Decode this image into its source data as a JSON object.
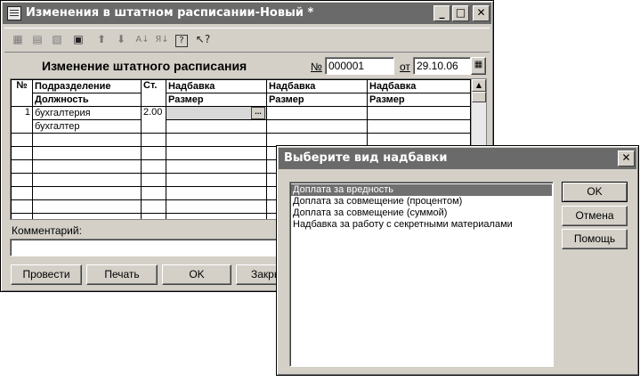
{
  "main_window": {
    "title": "Изменения в штатном расписании-Новый *",
    "controls": {
      "minimize": "_",
      "maximize": "□",
      "close": "✕"
    },
    "toolbar_icons": [
      "new-row-icon",
      "copy-row-icon",
      "delete-row-icon",
      "edit-row-icon",
      "move-up-icon",
      "move-down-icon",
      "sort-asc-icon",
      "sort-desc-icon",
      "help-icon",
      "context-help-icon"
    ],
    "form_title": "Изменение штатного расписания",
    "number_label": "№",
    "number_value": "000001",
    "date_label": "от",
    "date_value": "29.10.06",
    "table": {
      "headers_row1": [
        "№",
        "Подразделение",
        "Ст.",
        "Надбавка",
        "Надбавка",
        "Надбавка"
      ],
      "headers_row2": [
        "Должность",
        "Размер",
        "Размер",
        "Размер"
      ],
      "rows": [
        {
          "num": "1",
          "dept": "бухгалтерия",
          "rate": "2.00",
          "position": "бухгалтер"
        }
      ],
      "cell_button": "..."
    },
    "comment_label": "Комментарий:",
    "comment_value": "",
    "buttons": {
      "post": "Провести",
      "print": "Печать",
      "ok": "OK",
      "close": "Закры"
    }
  },
  "dialog": {
    "title": "Выберите вид надбавки",
    "close": "✕",
    "items": [
      "Доплата за вредность",
      "Доплата за совмещение (процентом)",
      "Доплата за совмещение (суммой)",
      "Надбавка за работу с секретными материалами"
    ],
    "selected_index": 0,
    "buttons": {
      "ok": "OK",
      "cancel": "Отмена",
      "help": "Помощь"
    }
  }
}
